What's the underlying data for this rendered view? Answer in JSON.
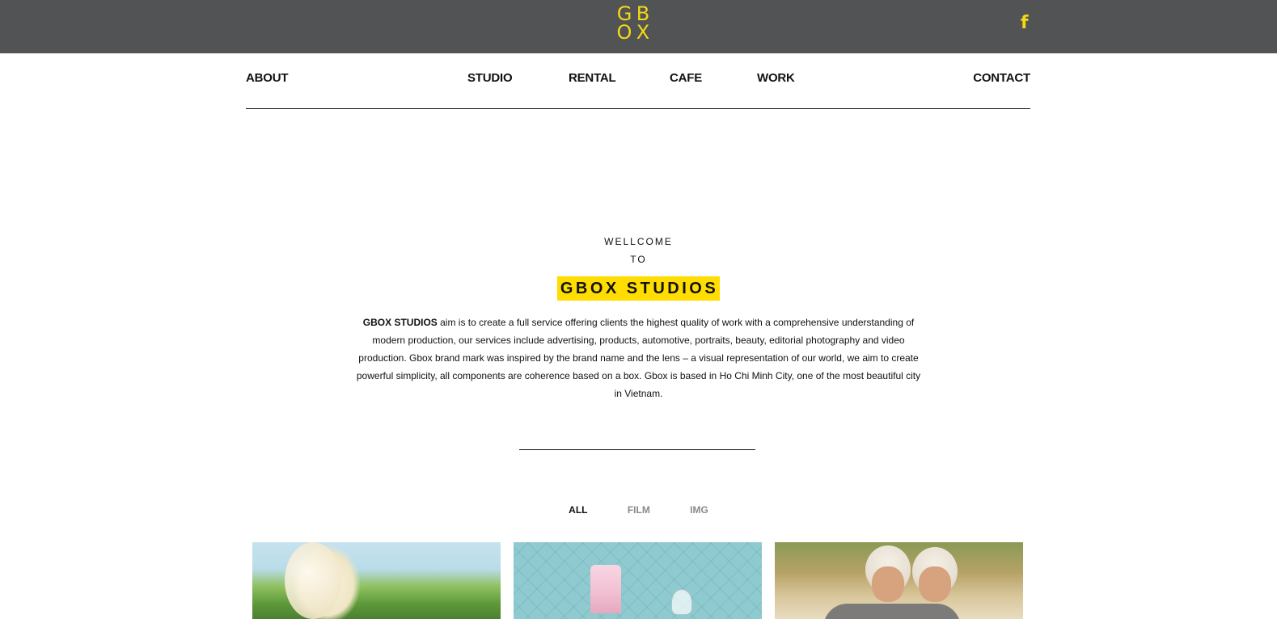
{
  "header": {
    "logo_letters": [
      "G",
      "B",
      "O",
      "X"
    ],
    "brand_color": "#f5d915",
    "bar_color": "#525354",
    "facebook_icon": "f"
  },
  "nav": {
    "about": "ABOUT",
    "studio": "STUDIO",
    "rental": "RENTAL",
    "cafe": "CAFE",
    "work": "WORK",
    "contact": "CONTACT"
  },
  "welcome": {
    "line1": "WELLCOME",
    "line2": "TO",
    "brand": "GBOX STUDIOS",
    "highlight_color": "#ffdd00"
  },
  "intro": {
    "bold_lead": "GBOX STUDIOS",
    "body": " aim is to create a full service offering clients the highest quality of work with a comprehensive understanding of modern production, our services include advertising, products, automotive, portraits, beauty, editorial photography and video production. Gbox brand mark was inspired by the brand name and the lens – a visual representation of our world, we aim to create powerful simplicity, all components are coherence based on a box. Gbox is based in Ho Chi Minh City, one of the most beautiful city in Vietnam."
  },
  "filters": {
    "all": "ALL",
    "film": "FILM",
    "img": "IMG",
    "active": "ALL"
  },
  "gallery": {
    "items": [
      {
        "icon": "moon-fantasy-image"
      },
      {
        "icon": "cake-quilted-image"
      },
      {
        "icon": "helmet-couple-image"
      }
    ]
  }
}
